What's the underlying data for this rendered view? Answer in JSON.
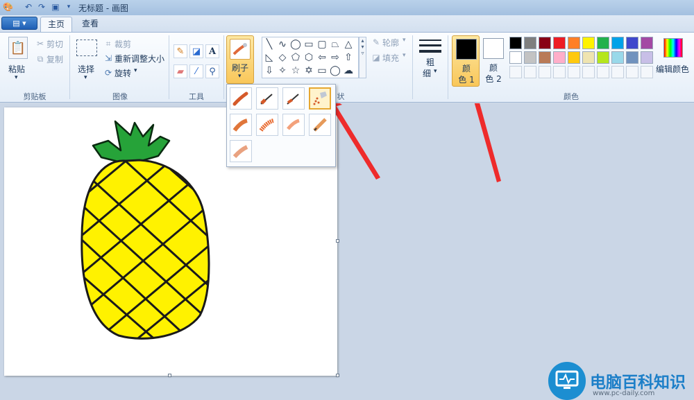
{
  "window": {
    "title": "无标题 - 画图"
  },
  "tabs": [
    {
      "label": "主页"
    },
    {
      "label": "查看"
    }
  ],
  "clipboard": {
    "paste": "粘贴",
    "cut": "剪切",
    "copy": "复制",
    "group": "剪贴板"
  },
  "image": {
    "select": "选择",
    "crop": "裁剪",
    "resize": "重新调整大小",
    "rotate": "旋转",
    "group": "图像"
  },
  "tools": {
    "group": "工具",
    "text_glyph": "A"
  },
  "brushes": {
    "label": "刷子"
  },
  "shapes": {
    "outline": "轮廓",
    "fill": "填充",
    "group_tail": "状"
  },
  "size": {
    "label_line1": "粗",
    "label_line2": "细"
  },
  "colors": {
    "color1_line1": "颜",
    "color1_line2": "色 1",
    "color2_line1": "颜",
    "color2_line2": "色 2",
    "edit": "编辑颜色",
    "group": "颜色",
    "color1_value": "#000000",
    "color2_value": "#ffffff",
    "palette_row1": [
      "#000000",
      "#7f7f7f",
      "#880015",
      "#ed1c24",
      "#ff7f27",
      "#fff200",
      "#22b14c",
      "#00a2e8",
      "#3f48cc",
      "#a349a4"
    ],
    "palette_row2": [
      "#ffffff",
      "#c3c3c3",
      "#b97a57",
      "#ffaec9",
      "#ffc90e",
      "#efe4b0",
      "#b5e61d",
      "#99d9ea",
      "#7092be",
      "#c8bfe7"
    ]
  },
  "watermark": {
    "title": "电脑百科知识",
    "url": "www.pc-daily.com"
  }
}
